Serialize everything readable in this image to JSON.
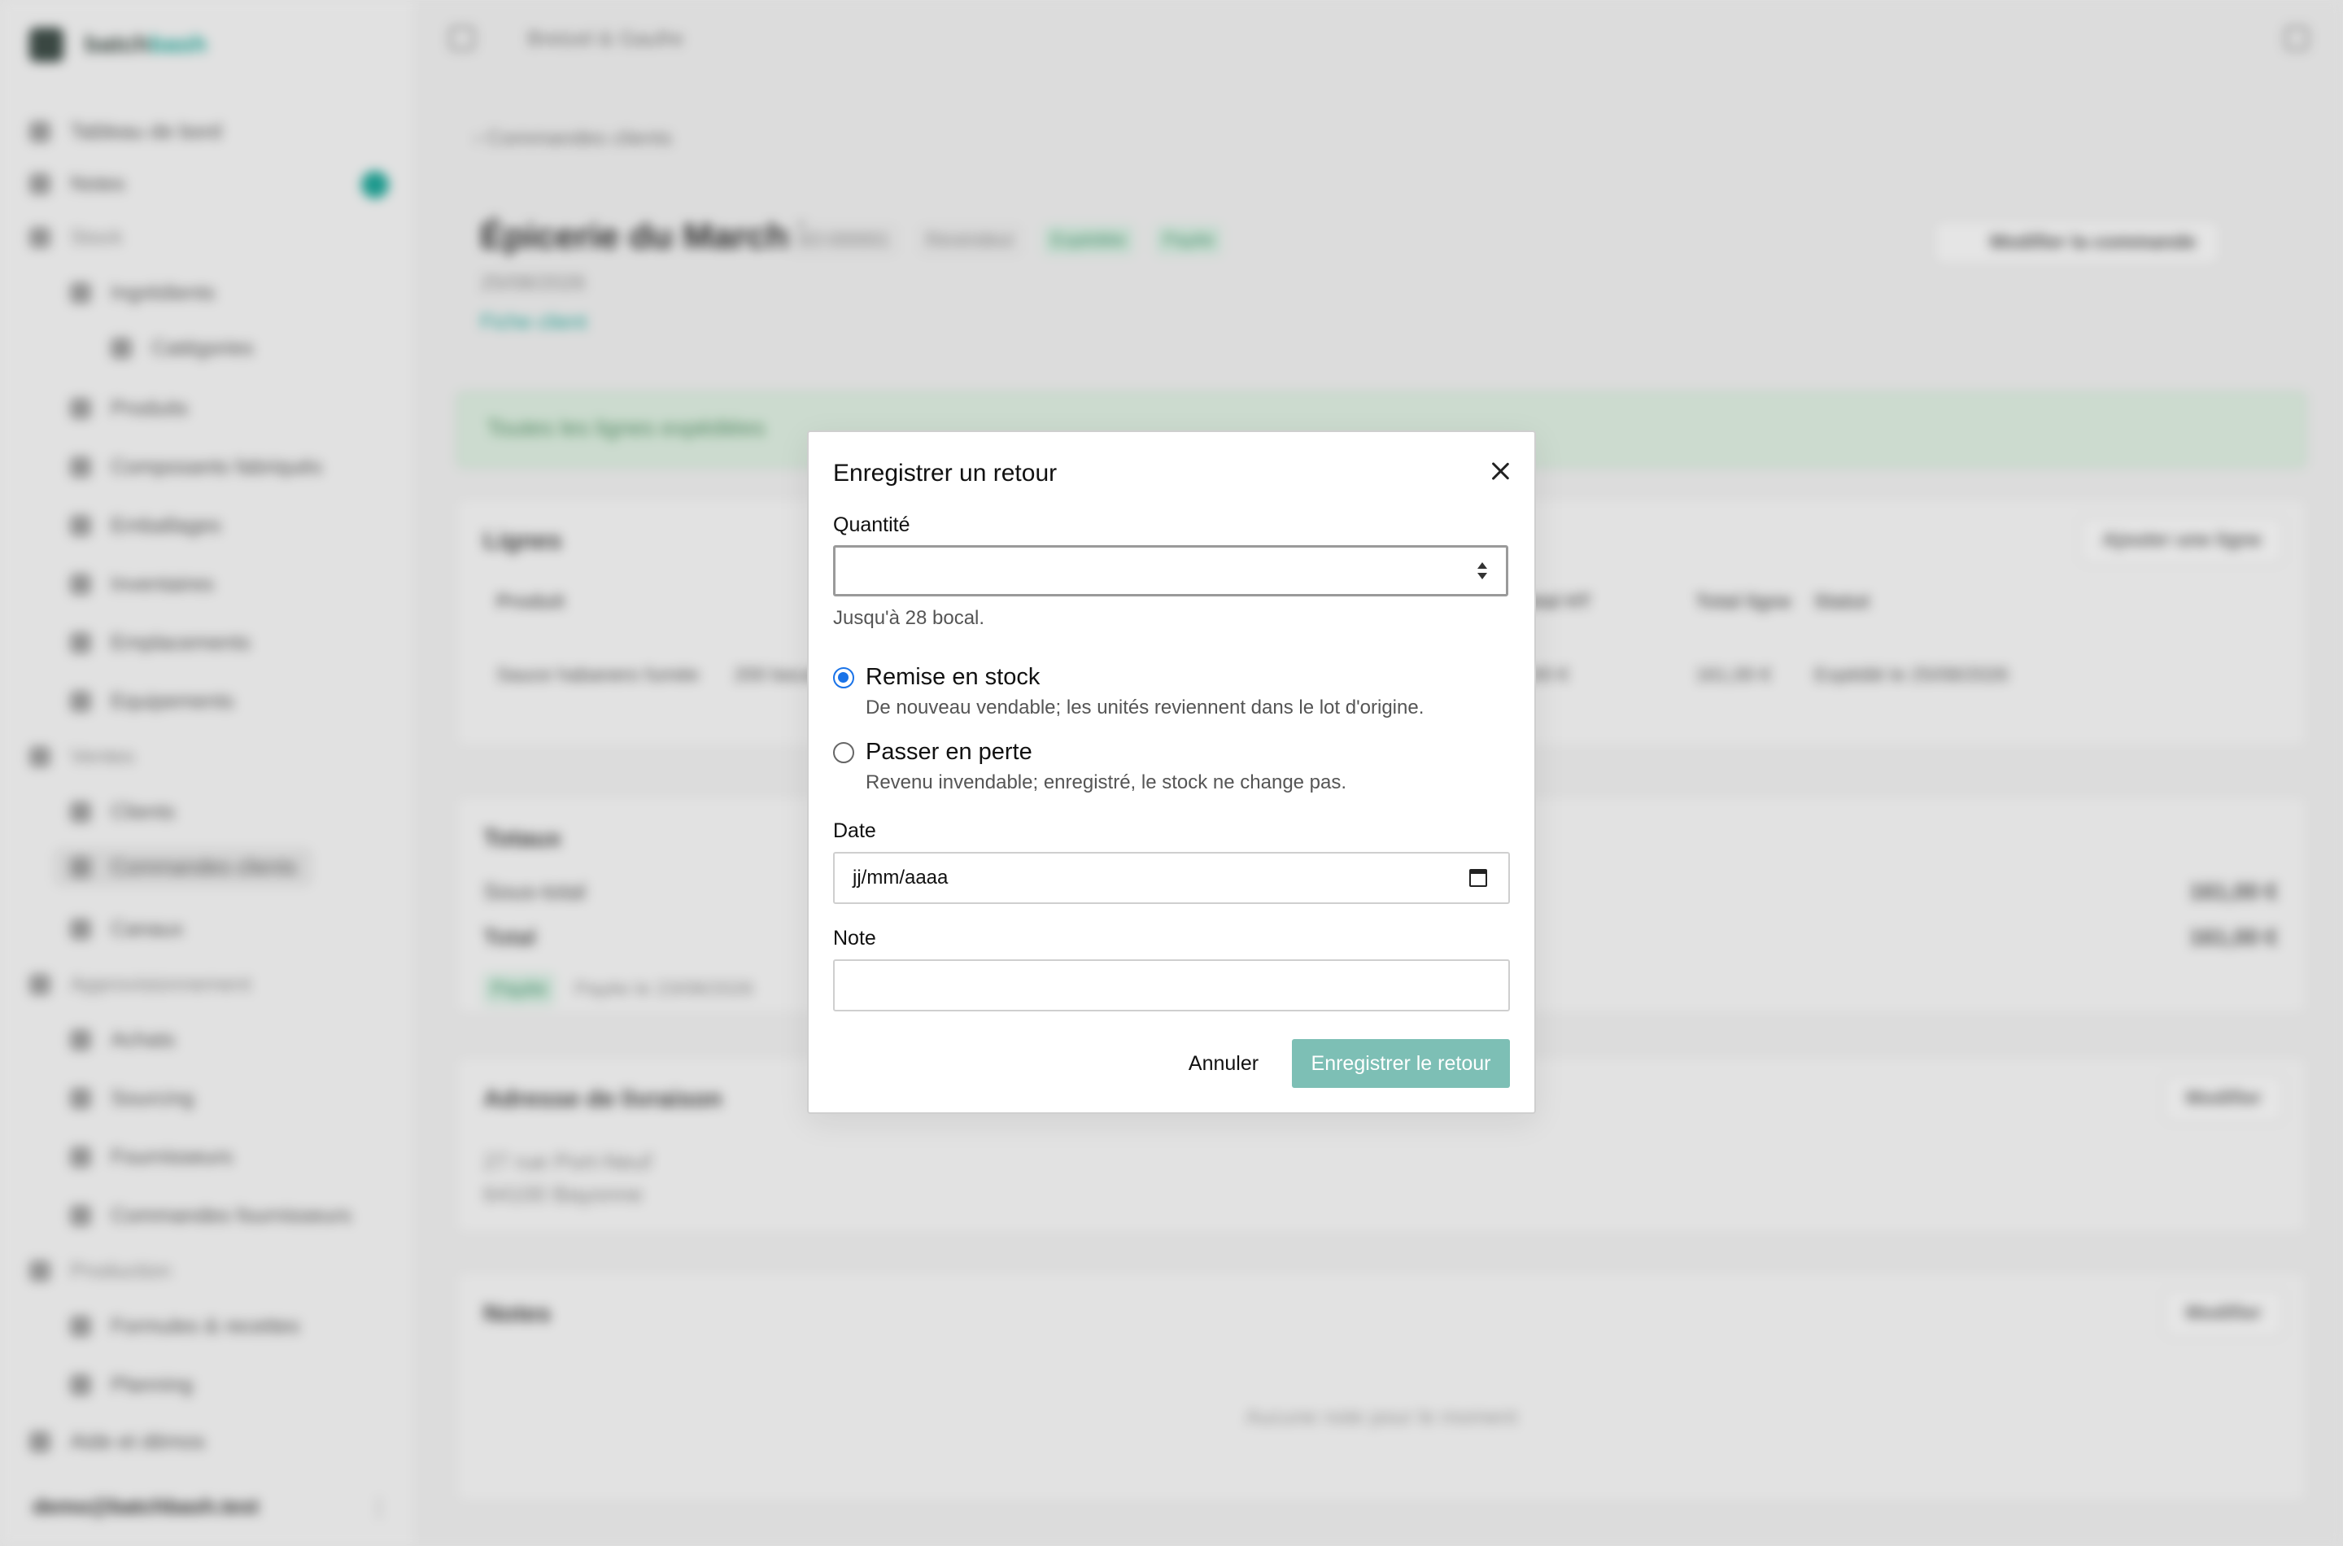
{
  "background": {
    "brand": {
      "name_a": "batch",
      "name_b": "bash"
    },
    "sidebar": {
      "items": [
        {
          "label": "Tableau de bord"
        },
        {
          "label": "Notes"
        },
        {
          "label": "Stock"
        },
        {
          "label": "Ingrédients"
        },
        {
          "label": "Catégories"
        },
        {
          "label": "Produits"
        },
        {
          "label": "Composants fabriqués"
        },
        {
          "label": "Emballages"
        },
        {
          "label": "Inventaires"
        },
        {
          "label": "Emplacements"
        },
        {
          "label": "Equipements"
        },
        {
          "label": "Ventes"
        },
        {
          "label": "Clients"
        },
        {
          "label": "Commandes clients"
        },
        {
          "label": "Canaux"
        },
        {
          "label": "Approvisionnement"
        },
        {
          "label": "Achats"
        },
        {
          "label": "Sourcing"
        },
        {
          "label": "Fournisseurs"
        },
        {
          "label": "Commandes fournisseurs"
        },
        {
          "label": "Production"
        },
        {
          "label": "Formules & recettes"
        },
        {
          "label": "Planning"
        },
        {
          "label": "Aide et démos"
        }
      ],
      "user": "demo@batchbash.test",
      "user_more": "⋮"
    },
    "topbar": {
      "breadcrumb": "Bretzel & Gaufre"
    },
    "order": {
      "back_link": "Commandes clients",
      "title": "Épicerie du Marché",
      "number": "SO-000001",
      "channel": "Revendeur",
      "status_shipped": "Expédiée",
      "status_paid": "Payée",
      "date": "25/08/2026",
      "client_link": "Fiche client",
      "edit_button": "Modifier la commande",
      "banner": "Toutes les lignes expédiées"
    },
    "lines": {
      "title": "Lignes",
      "add_button": "Ajouter une ligne",
      "headers": [
        "Produit",
        "Total HT",
        "Total ligne",
        "Statut"
      ],
      "row": {
        "product": "Sauce habanero fumée",
        "lot": "200 bocal",
        "unit": "7,00 €",
        "total": "161,00 €",
        "status": "Expédié le 25/08/2026"
      }
    },
    "totals": {
      "title": "Totaux",
      "subtotal_label": "Sous-total",
      "subtotal_value": "161,00 €",
      "total_label": "Total",
      "total_value": "161,00 €",
      "paid_pill": "Payée",
      "paid_text": "Payée le 23/08/2026"
    },
    "address": {
      "title": "Adresse de livraison",
      "edit_button": "Modifier",
      "line1": "27 rue Port-Neuf",
      "line2": "64100 Bayonne"
    },
    "notes": {
      "title": "Notes",
      "edit_button": "Modifier",
      "empty": "Aucune note pour le moment"
    }
  },
  "modal": {
    "title": "Enregistrer un retour",
    "quantity": {
      "label": "Quantité",
      "value": "",
      "hint": "Jusqu'à 28 bocal."
    },
    "options": [
      {
        "label": "Remise en stock",
        "description": "De nouveau vendable; les unités reviennent dans le lot d'origine.",
        "checked": true
      },
      {
        "label": "Passer en perte",
        "description": "Revenu invendable; enregistré, le stock ne change pas.",
        "checked": false
      }
    ],
    "date": {
      "label": "Date",
      "placeholder": "jj/mm/aaaa"
    },
    "note": {
      "label": "Note",
      "value": ""
    },
    "cancel_label": "Annuler",
    "submit_label": "Enregistrer le retour",
    "colors": {
      "submit_bg": "#7dbfb5",
      "radio_accent": "#1a73e8"
    }
  }
}
